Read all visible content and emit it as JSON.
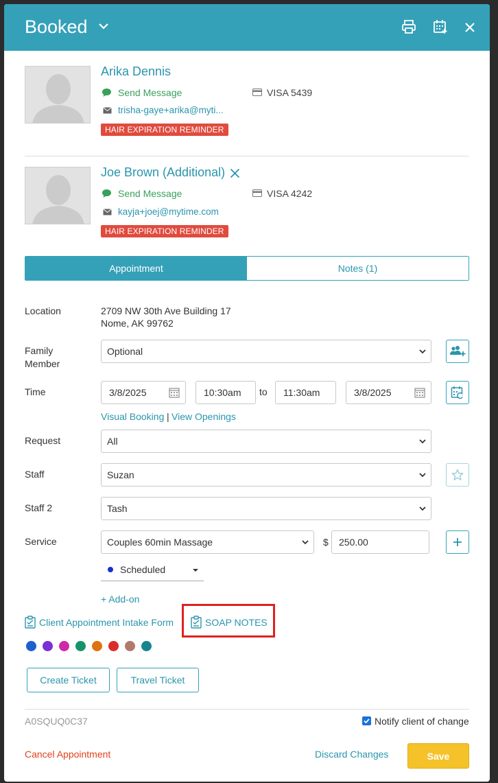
{
  "header": {
    "title": "Booked"
  },
  "clients": [
    {
      "name": "Arika Dennis",
      "send_message": "Send Message",
      "email": "trisha-gaye+arika@myti...",
      "card": "VISA 5439",
      "badge": "HAIR EXPIRATION REMINDER"
    },
    {
      "name": "Joe Brown (Additional)",
      "send_message": "Send Message",
      "email": "kayja+joej@mytime.com",
      "card": "VISA 4242",
      "badge": "HAIR EXPIRATION REMINDER"
    }
  ],
  "tabs": [
    {
      "label": "Appointment",
      "active": true
    },
    {
      "label": "Notes (1)",
      "active": false
    }
  ],
  "form": {
    "location_label": "Location",
    "location_line1": "2709 NW 30th Ave Building 17",
    "location_line2": "Nome, AK 99762",
    "family_label_1": "Family",
    "family_label_2": "Member",
    "family_value": "Optional",
    "time_label": "Time",
    "start_date": "3/8/2025",
    "start_time": "10:30am",
    "to_label": "to",
    "end_time": "11:30am",
    "end_date": "3/8/2025",
    "visual_booking": "Visual Booking",
    "separator": "|",
    "view_openings": "View Openings",
    "request_label": "Request",
    "request_value": "All",
    "staff_label": "Staff",
    "staff_value": "Suzan",
    "staff2_label": "Staff 2",
    "staff2_value": "Tash",
    "service_label": "Service",
    "service_value": "Couples 60min Massage",
    "currency": "$",
    "price": "250.00",
    "status": "Scheduled",
    "status_color": "#1a2fd0",
    "add_on": "+ Add-on",
    "intake_form": "Client Appointment Intake Form",
    "soap_notes": "SOAP NOTES"
  },
  "color_dots": [
    "#1f5fd0",
    "#7b2fd6",
    "#cf28a8",
    "#17936a",
    "#e0720f",
    "#dc2b2b",
    "#b07a6c",
    "#17858f"
  ],
  "buttons": {
    "create_ticket": "Create Ticket",
    "travel_ticket": "Travel Ticket",
    "cancel_appointment": "Cancel Appointment",
    "discard_changes": "Discard Changes",
    "save": "Save"
  },
  "footer": {
    "appointment_id": "A0SQUQ0C37",
    "notify_label": "Notify client of change",
    "notify_checked": true
  }
}
